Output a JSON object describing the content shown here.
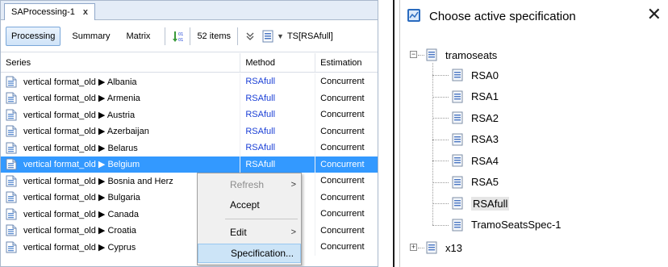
{
  "left": {
    "tab_title": "SAProcessing-1",
    "tab_close": "x",
    "toolbar": {
      "processing": "Processing",
      "summary": "Summary",
      "matrix": "Matrix",
      "items_count": "52 items",
      "ts_label": "TS[RSAfull]"
    },
    "columns": {
      "series": "Series",
      "method": "Method",
      "estimation": "Estimation"
    },
    "rows": [
      {
        "series": "vertical format_old ▶ Albania",
        "method": "RSAfull",
        "estimation": "Concurrent"
      },
      {
        "series": "vertical format_old ▶ Armenia",
        "method": "RSAfull",
        "estimation": "Concurrent"
      },
      {
        "series": "vertical format_old ▶ Austria",
        "method": "RSAfull",
        "estimation": "Concurrent"
      },
      {
        "series": "vertical format_old ▶ Azerbaijan",
        "method": "RSAfull",
        "estimation": "Concurrent"
      },
      {
        "series": "vertical format_old ▶ Belarus",
        "method": "RSAfull",
        "estimation": "Concurrent"
      },
      {
        "series": "vertical format_old ▶ Belgium",
        "method": "RSAfull",
        "estimation": "Concurrent"
      },
      {
        "series": "vertical format_old ▶ Bosnia and Herz",
        "method": "",
        "estimation": "Concurrent"
      },
      {
        "series": "vertical format_old ▶ Bulgaria",
        "method": "",
        "estimation": "Concurrent"
      },
      {
        "series": "vertical format_old ▶ Canada",
        "method": "",
        "estimation": "Concurrent"
      },
      {
        "series": "vertical format_old ▶ Croatia",
        "method": "",
        "estimation": "Concurrent"
      },
      {
        "series": "vertical format_old ▶ Cyprus",
        "method": "",
        "estimation": "Concurrent"
      }
    ],
    "context_menu": {
      "refresh": "Refresh",
      "accept": "Accept",
      "edit": "Edit",
      "specification": "Specification...",
      "submenu_arrow": ">"
    }
  },
  "dialog": {
    "title": "Choose active specification",
    "close": "✕",
    "tree": {
      "root": "tramoseats",
      "root_expander": "−",
      "children": [
        "RSA0",
        "RSA1",
        "RSA2",
        "RSA3",
        "RSA4",
        "RSA5",
        "RSAfull",
        "TramoSeatsSpec-1"
      ],
      "selected": "RSAfull",
      "other_root": "x13",
      "other_expander": "+"
    }
  },
  "colors": {
    "selection": "#3399ff",
    "method_link": "#1a3fd6",
    "menu_highlight": "#cce4f7"
  },
  "icons": {
    "doc": "document-icon",
    "sort": "sort-icon",
    "filter": "filter-icon",
    "spec": "spec-icon",
    "app": "app-icon"
  }
}
